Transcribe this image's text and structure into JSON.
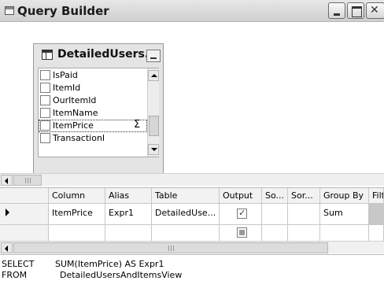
{
  "window": {
    "title": "Query Builder"
  },
  "diagram": {
    "table": {
      "title": "DetailedUsers...",
      "columns": [
        {
          "name": "IsPaid",
          "checked": false
        },
        {
          "name": "ItemId",
          "checked": false
        },
        {
          "name": "OurItemId",
          "checked": false
        },
        {
          "name": "ItemName",
          "checked": false
        },
        {
          "name": "ItemPrice",
          "checked": false,
          "selected": true,
          "aggregate_symbol": "Σ"
        },
        {
          "name": "TransactionI",
          "checked": false
        }
      ]
    }
  },
  "grid": {
    "headers": [
      "Column",
      "Alias",
      "Table",
      "Output",
      "So...",
      "Sor...",
      "Group By",
      "Filte"
    ],
    "rows": [
      {
        "current": true,
        "column": "ItemPrice",
        "alias": "Expr1",
        "table": "DetailedUse...",
        "output": "checked",
        "sort_type": "",
        "sort_order": "",
        "group_by": "Sum",
        "filter": ""
      },
      {
        "current": false,
        "column": "",
        "alias": "",
        "table": "",
        "output": "disabled",
        "sort_type": "",
        "sort_order": "",
        "group_by": "",
        "filter": ""
      }
    ]
  },
  "sql": {
    "select_keyword": "SELECT",
    "select_expression": "SUM(ItemPrice) AS Expr1",
    "from_keyword": "FROM",
    "from_expression": "DetailedUsersAndItemsView"
  },
  "icons": {
    "window": "query-builder-window-icon",
    "table": "table-icon",
    "minimize": "minimize-icon",
    "maximize": "maximize-icon",
    "close": "close-icon",
    "row_indicator": "current-row-arrow-icon",
    "aggregate": "sigma-icon"
  },
  "colors": {
    "title_bar": "#d9d9d9",
    "grid_header": "#f2f2f2",
    "filter_cell_shaded": "#c8c8c8"
  }
}
